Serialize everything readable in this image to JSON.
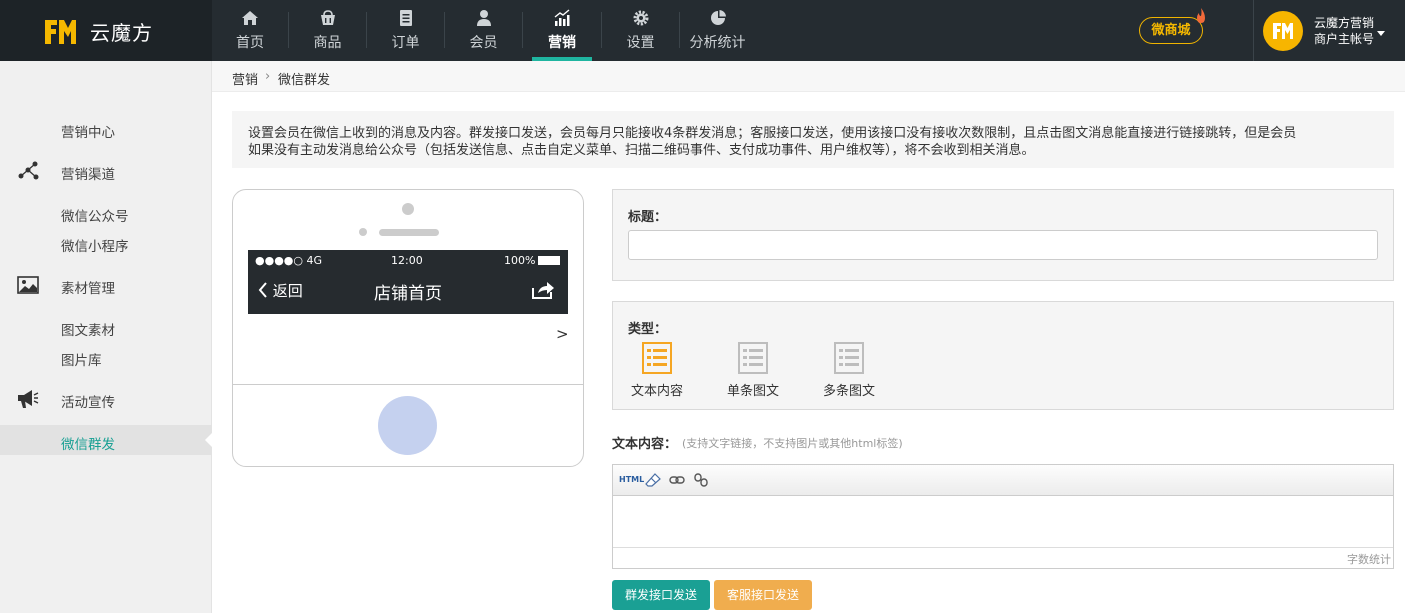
{
  "brand": {
    "name": "云魔方",
    "accent": "#1fb5a0",
    "logo_color": "#f5b800"
  },
  "nav": {
    "items": [
      {
        "label": "首页",
        "icon": "home-icon",
        "active": false
      },
      {
        "label": "商品",
        "icon": "basket-icon",
        "active": false
      },
      {
        "label": "订单",
        "icon": "document-icon",
        "active": false
      },
      {
        "label": "会员",
        "icon": "user-icon",
        "active": false
      },
      {
        "label": "营销",
        "icon": "chart-up-icon",
        "active": true
      },
      {
        "label": "设置",
        "icon": "gear-icon",
        "active": false
      },
      {
        "label": "分析统计",
        "icon": "pie-icon",
        "active": false
      }
    ],
    "shop_badge": "微商城",
    "user": {
      "name": "云魔方营销",
      "account": "商户主帐号"
    }
  },
  "sidebar": {
    "items": [
      {
        "label": "营销中心",
        "icon": ""
      },
      {
        "label": "营销渠道",
        "icon": "network-icon"
      },
      {
        "label": "微信公众号",
        "icon": ""
      },
      {
        "label": "微信小程序",
        "icon": ""
      },
      {
        "label": "素材管理",
        "icon": "image-icon"
      },
      {
        "label": "图文素材",
        "icon": ""
      },
      {
        "label": "图片库",
        "icon": ""
      },
      {
        "label": "活动宣传",
        "icon": "megaphone-icon"
      },
      {
        "label": "微信群发",
        "icon": "",
        "active": true
      }
    ]
  },
  "breadcrumb": {
    "root": "营销",
    "separator": "›",
    "current": "微信群发"
  },
  "notice": {
    "line1": "设置会员在微信上收到的消息及内容。群发接口发送，会员每月只能接收4条群发消息；客服接口发送，使用该接口没有接收次数限制，且点击图文消息能直接进行链接跳转，但是会员",
    "line2": "如果没有主动发消息给公众号（包括发送信息、点击自定义菜单、扫描二维码事件、支付成功事件、用户维权等），将不会收到相关消息。"
  },
  "phone": {
    "signal": "●●●●○ 4G",
    "time": "12:00",
    "battery": "100%",
    "back": "返回",
    "title": "店铺首页",
    "arrow": ">"
  },
  "form": {
    "title_label": "标题：",
    "title_value": "",
    "type_label": "类型：",
    "types": [
      {
        "label": "文本内容",
        "selected": true
      },
      {
        "label": "单条图文",
        "selected": false
      },
      {
        "label": "多条图文",
        "selected": false
      }
    ],
    "content_label": "文本内容：",
    "content_hint": "(支持文字链接，不支持图片或其他html标签)",
    "toolbar": {
      "html": "HTML"
    },
    "word_count": "字数统计",
    "buttons": {
      "mass_send": "群发接口发送",
      "service_send": "客服接口发送"
    }
  },
  "colors": {
    "selected_type": "#f5a623",
    "unselected_type": "#bdbdbd",
    "btn_primary": "#1aa094",
    "btn_warning": "#f0ad4e"
  }
}
